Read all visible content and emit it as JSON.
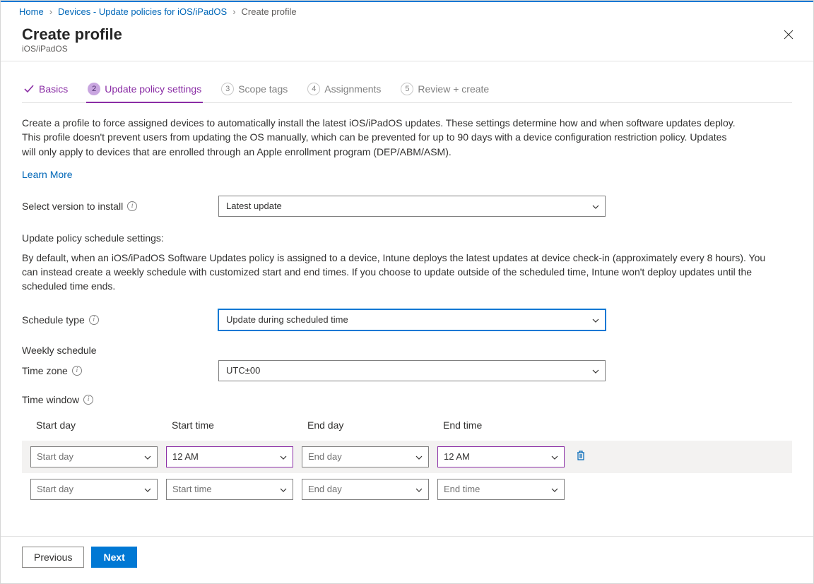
{
  "breadcrumb": {
    "home": "Home",
    "devices": "Devices - Update policies for iOS/iPadOS",
    "current": "Create profile"
  },
  "header": {
    "title": "Create profile",
    "subtitle": "iOS/iPadOS"
  },
  "tabs": {
    "basics": "Basics",
    "update": "Update policy settings",
    "scope": "Scope tags",
    "assignments": "Assignments",
    "review": "Review + create",
    "n2": "2",
    "n3": "3",
    "n4": "4",
    "n5": "5"
  },
  "body": {
    "description": "Create a profile to force assigned devices to automatically install the latest iOS/iPadOS updates. These settings determine how and when software updates deploy. This profile doesn't prevent users from updating the OS manually, which can be prevented for up to 90 days with a device configuration restriction policy. Updates will only apply to devices that are enrolled through an Apple enrollment program (DEP/ABM/ASM).",
    "learn_more": "Learn More",
    "select_version_label": "Select version to install",
    "select_version_value": "Latest update",
    "schedule_settings_label": "Update policy schedule settings:",
    "schedule_paragraph": "By default, when an iOS/iPadOS Software Updates policy is assigned to a device, Intune deploys the latest updates at device check-in (approximately every 8 hours). You can instead create a weekly schedule with customized start and end times. If you choose to update outside of the scheduled time, Intune won't deploy updates until the scheduled time ends.",
    "schedule_type_label": "Schedule type",
    "schedule_type_value": "Update during scheduled time",
    "weekly_schedule_label": "Weekly schedule",
    "timezone_label": "Time zone",
    "timezone_value": "UTC±00",
    "timewindow_label": "Time window"
  },
  "table": {
    "headers": {
      "start_day": "Start day",
      "start_time": "Start time",
      "end_day": "End day",
      "end_time": "End time"
    },
    "rows": [
      {
        "start_day": "Start day",
        "start_time": "12 AM",
        "end_day": "End day",
        "end_time": "12 AM",
        "has_delete": true,
        "sd_ph": true,
        "ed_ph": true
      },
      {
        "start_day": "Start day",
        "start_time": "Start time",
        "end_day": "End day",
        "end_time": "End time",
        "has_delete": false,
        "sd_ph": true,
        "st_ph": true,
        "ed_ph": true,
        "et_ph": true
      }
    ]
  },
  "footer": {
    "previous": "Previous",
    "next": "Next"
  }
}
